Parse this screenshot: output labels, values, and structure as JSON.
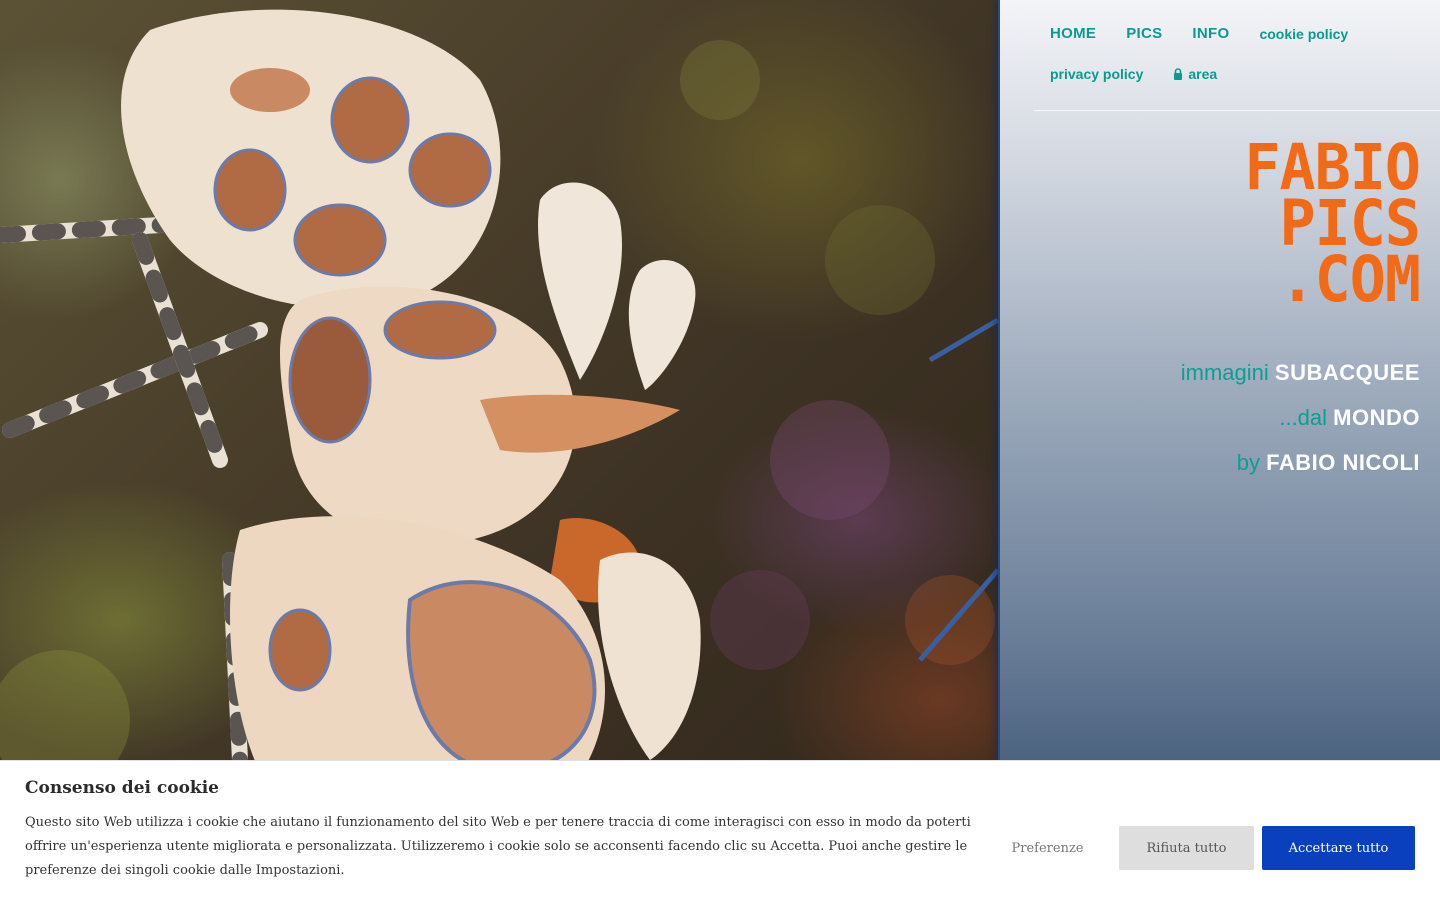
{
  "nav": {
    "items": [
      {
        "label": "HOME"
      },
      {
        "label": "PICS"
      },
      {
        "label": "INFO"
      },
      {
        "label": "cookie policy"
      },
      {
        "label": "privacy policy"
      },
      {
        "label": "area",
        "icon": "lock-icon"
      }
    ]
  },
  "logo": {
    "lines": [
      "FABIO",
      "PICS",
      ".COM"
    ]
  },
  "tagline": [
    {
      "lead": "immagini",
      "strong": "SUBACQUEE"
    },
    {
      "lead": "...dal",
      "strong": "MONDO"
    },
    {
      "lead": "by",
      "strong": "FABIO NICOLI"
    }
  ],
  "cookie": {
    "title": "Consenso dei cookie",
    "text": "Questo sito Web utilizza i cookie che aiutano il funzionamento del sito Web e per tenere traccia di come interagisci con esso in modo da poterti offrire un'esperienza utente migliorata e personalizzata. Utilizzeremo i cookie solo se acconsenti facendo clic su Accetta. Puoi anche gestire le preferenze dei singoli cookie dalle Impostazioni.",
    "preferences_label": "Preferenze",
    "reject_label": "Rifiuta tutto",
    "accept_label": "Accettare tutto"
  },
  "colors": {
    "nav_link": "#0a9a8e",
    "logo": "#f26a16",
    "accept_button": "#0a3fbd"
  }
}
